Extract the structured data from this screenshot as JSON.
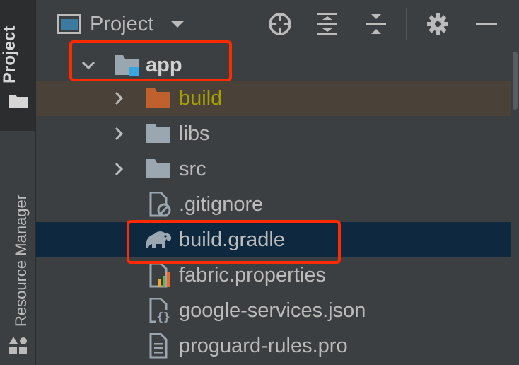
{
  "stripe": {
    "project_tab": "Project",
    "resource_tab": "Resource Manager"
  },
  "toolbar": {
    "view_label": "Project",
    "icons": [
      "locate-icon",
      "expand-all-icon",
      "collapse-all-icon",
      "gear-icon",
      "minimize-icon"
    ]
  },
  "tree": {
    "items": [
      {
        "label": "app",
        "icon": "module-folder-icon",
        "expanded": true
      },
      {
        "label": "build",
        "icon": "excluded-folder-icon",
        "expanded": false
      },
      {
        "label": "libs",
        "icon": "folder-icon",
        "expanded": false
      },
      {
        "label": "src",
        "icon": "folder-icon",
        "expanded": false
      },
      {
        "label": ".gitignore",
        "icon": "ignore-file-icon"
      },
      {
        "label": "build.gradle",
        "icon": "gradle-elephant-icon"
      },
      {
        "label": "fabric.properties",
        "icon": "properties-file-icon"
      },
      {
        "label": "google-services.json",
        "icon": "json-file-icon"
      },
      {
        "label": "proguard-rules.pro",
        "icon": "text-file-icon"
      }
    ]
  },
  "colors": {
    "background": "#3c3f41",
    "selection": "#0e293f",
    "excluded_row": "#4a4238",
    "excluded_text": "#a3a000",
    "annotation": "#ff2a00",
    "module_badge": "#3aa6e0",
    "excluded_folder": "#c0602f"
  }
}
